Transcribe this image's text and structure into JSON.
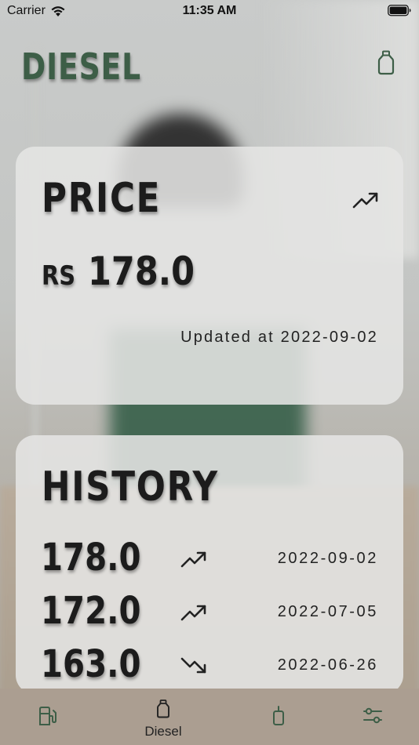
{
  "status_bar": {
    "carrier": "Carrier",
    "time": "11:35 AM"
  },
  "header": {
    "title": "DIESEL",
    "icon": "fuel-can-icon",
    "title_color": "#3d5e47"
  },
  "price_card": {
    "heading": "PRICE",
    "trend_icon": "trending-up-icon",
    "currency": "RS",
    "amount": "178.0",
    "updated": "Updated at 2022-09-02"
  },
  "history_card": {
    "heading": "HISTORY",
    "rows": [
      {
        "value": "178.0",
        "trend": "up",
        "date": "2022-09-02"
      },
      {
        "value": "172.0",
        "trend": "up",
        "date": "2022-07-05"
      },
      {
        "value": "163.0",
        "trend": "down",
        "date": "2022-06-26"
      }
    ]
  },
  "tab_bar": {
    "background": "#ab9e91",
    "tabs": [
      {
        "icon": "gas-pump-icon",
        "label": ""
      },
      {
        "icon": "fuel-can-icon",
        "label": "Diesel",
        "selected": true
      },
      {
        "icon": "bottle-icon",
        "label": ""
      },
      {
        "icon": "sliders-icon",
        "label": ""
      }
    ]
  }
}
